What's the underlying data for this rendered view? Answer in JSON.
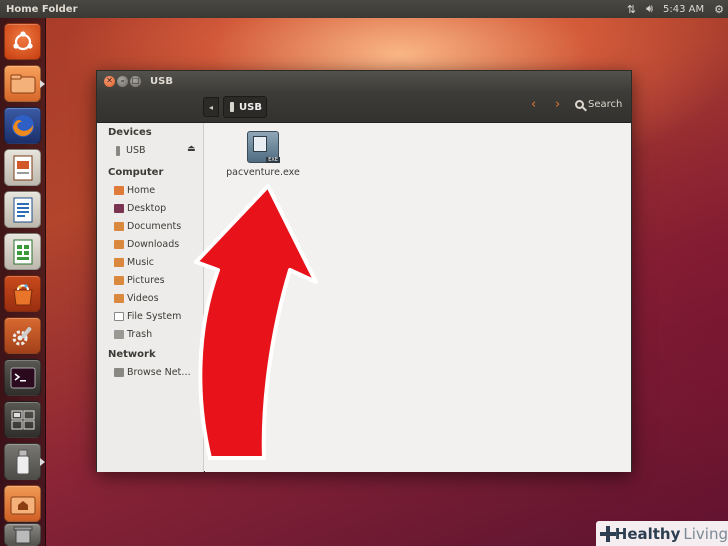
{
  "top_panel": {
    "app_title": "Home Folder",
    "clock": "5:43 AM",
    "indicators": [
      "network-icon",
      "volume-icon",
      "gear-icon"
    ]
  },
  "launcher": {
    "items": [
      {
        "name": "ubuntu-dash-icon",
        "color": "#dd4814"
      },
      {
        "name": "files-icon",
        "color": "#e8803a"
      },
      {
        "name": "firefox-icon",
        "color": "#e66000"
      },
      {
        "name": "libreoffice-impress-icon",
        "color": "#c4471e"
      },
      {
        "name": "libreoffice-writer-icon",
        "color": "#2d6db5"
      },
      {
        "name": "libreoffice-calc-icon",
        "color": "#3a9a3a"
      },
      {
        "name": "software-center-icon",
        "color": "#e0721b"
      },
      {
        "name": "system-settings-icon",
        "color": "#c4561e"
      },
      {
        "name": "terminal-icon",
        "color": "#3c3b37"
      },
      {
        "name": "workspace-switcher-icon",
        "color": "#4a4843"
      },
      {
        "name": "usb-drive-icon",
        "color": "#6a6a6a"
      },
      {
        "name": "home-folder-icon",
        "color": "#e07a38"
      },
      {
        "name": "trash-icon",
        "color": "#5a5a5a"
      }
    ]
  },
  "window": {
    "title": "USB",
    "location": "USB",
    "search_label": "Search"
  },
  "sidebar": {
    "devices_header": "Devices",
    "devices": [
      {
        "label": "USB",
        "icon": "usb-icon"
      }
    ],
    "computer_header": "Computer",
    "computer": [
      {
        "label": "Home",
        "icon": "home-icon"
      },
      {
        "label": "Desktop",
        "icon": "desktop-icon"
      },
      {
        "label": "Documents",
        "icon": "documents-icon"
      },
      {
        "label": "Downloads",
        "icon": "downloads-icon"
      },
      {
        "label": "Music",
        "icon": "music-icon"
      },
      {
        "label": "Pictures",
        "icon": "pictures-icon"
      },
      {
        "label": "Videos",
        "icon": "videos-icon"
      },
      {
        "label": "File System",
        "icon": "filesystem-icon"
      },
      {
        "label": "Trash",
        "icon": "trash-icon"
      }
    ],
    "network_header": "Network",
    "network": [
      {
        "label": "Browse Net…",
        "icon": "network-icon"
      }
    ]
  },
  "content": {
    "files": [
      {
        "name": "pacventure.exe",
        "icon": "exe-file-icon"
      }
    ]
  },
  "watermark": {
    "healthy": "Healthy",
    "living": "Living"
  }
}
